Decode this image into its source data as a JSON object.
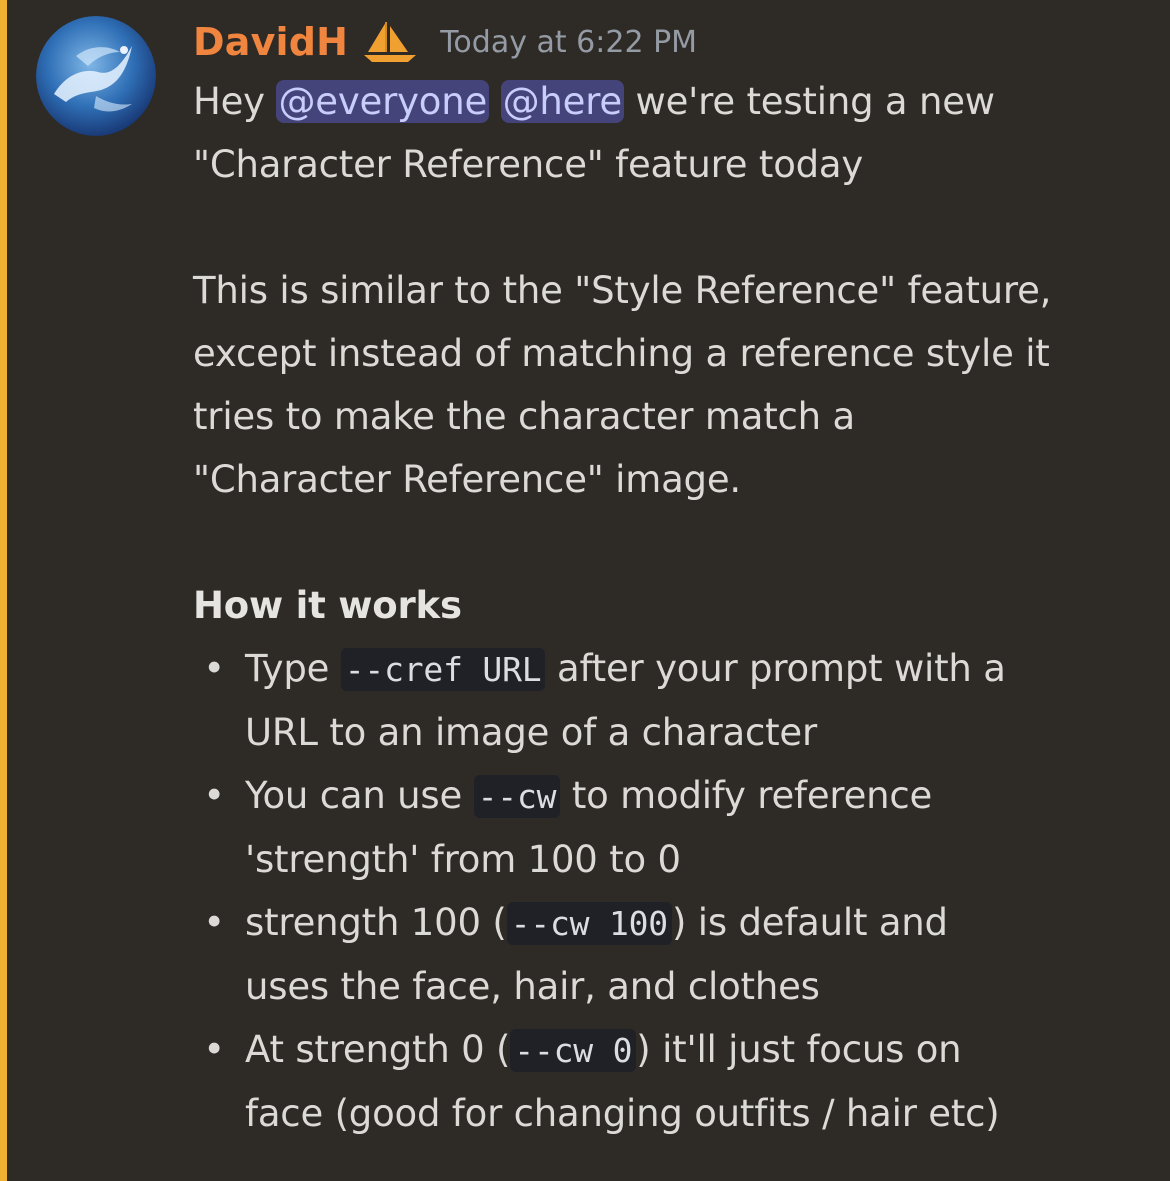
{
  "message": {
    "author": "DavidH",
    "author_badge_icon": "sailboat-icon",
    "timestamp": "Today at 6:22 PM",
    "colors": {
      "author": "#f0853f",
      "accent_bar": "#f0b132",
      "mention_bg": "#44447a"
    },
    "intro": {
      "prefix": "Hey ",
      "mention_everyone": "@everyone",
      "mention_here": "@here",
      "line1_suffix": " we're testing a new",
      "line2": "\"Character Reference\" feature today"
    },
    "paragraph2": {
      "line1": "This is similar to the \"Style Reference\" feature,",
      "line2": "except instead of matching a reference style it",
      "line3": "tries to make the character match a",
      "line4": "\"Character Reference\" image."
    },
    "section_heading": "How it works",
    "bullets": [
      {
        "pre": "Type ",
        "code": "--cref URL",
        "post_line1": " after your prompt with a",
        "line2": "URL to an image of a character"
      },
      {
        "pre": "You can use ",
        "code": "--cw",
        "post_line1": " to modify reference",
        "line2": "'strength' from 100 to 0"
      },
      {
        "pre": "strength 100 (",
        "code": "--cw 100",
        "post_line1": ") is default and",
        "line2": "uses the face, hair, and clothes"
      },
      {
        "pre": "At strength 0 (",
        "code": "--cw 0",
        "post_line1": ") it'll just focus on",
        "line2": "face (good for changing outfits / hair etc)"
      }
    ]
  }
}
